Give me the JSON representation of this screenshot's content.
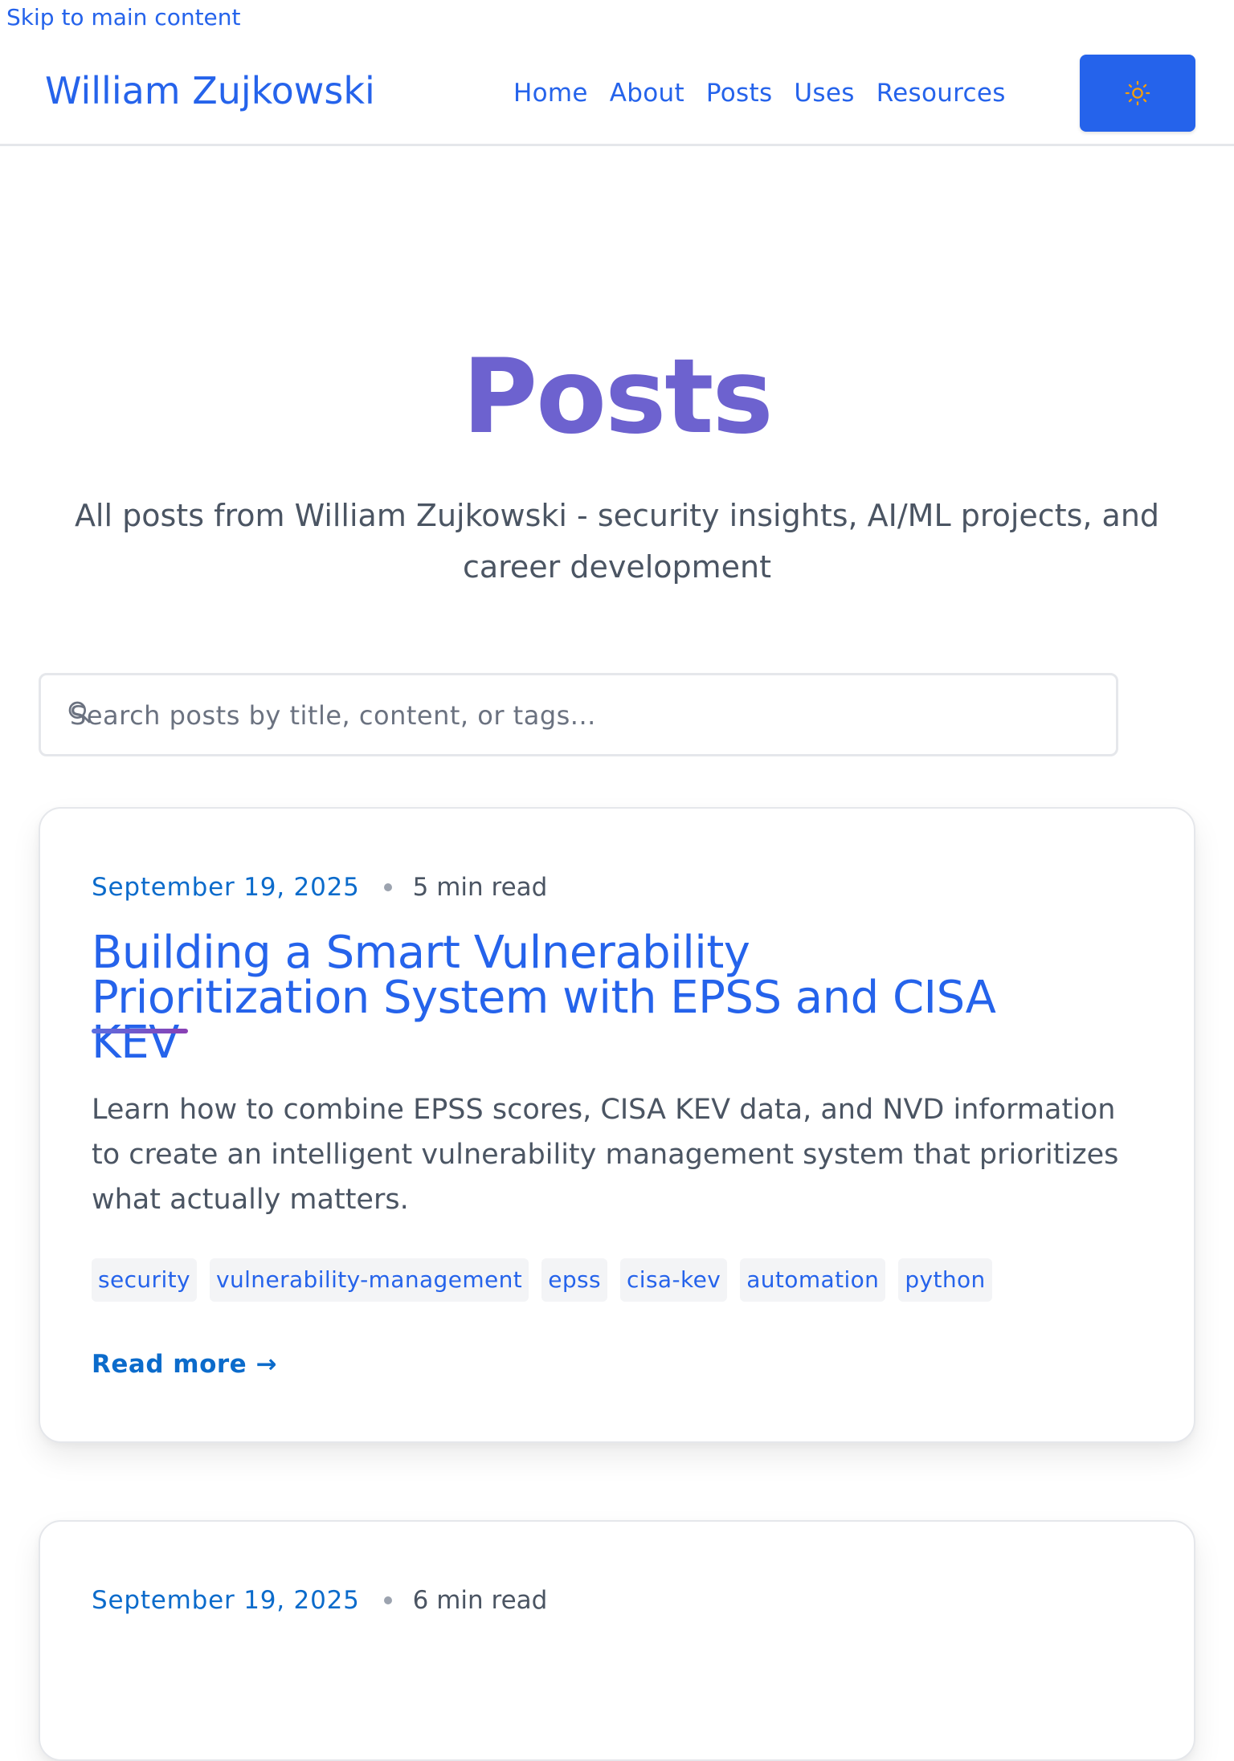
{
  "skip_link": "Skip to main content",
  "brand": "William Zujkowski",
  "nav": {
    "items": [
      "Home",
      "About",
      "Posts",
      "Uses",
      "Resources"
    ]
  },
  "theme_toggle": {
    "icon": "sun-icon"
  },
  "hero": {
    "title": "Posts",
    "subtitle": "All posts from William Zujkowski - security insights, AI/ML projects, and career development"
  },
  "search": {
    "placeholder": "Search posts by title, content, or tags..."
  },
  "posts": [
    {
      "date": "September 19, 2025",
      "read_time": "5 min read",
      "title": "Building a Smart Vulnerability Prioritization System with EPSS and CISA KEV",
      "excerpt": "Learn how to combine EPSS scores, CISA KEV data, and NVD information to create an intelligent vulnerability management system that prioritizes what actually matters.",
      "tags": [
        "security",
        "vulnerability-management",
        "epss",
        "cisa-kev",
        "automation",
        "python"
      ],
      "read_more": "Read more →"
    },
    {
      "date": "September 19, 2025",
      "read_time": "6 min read"
    }
  ],
  "colors": {
    "accent": "#2563eb",
    "hero_title": "#6d62cf",
    "date": "#0b6bcb",
    "body_text": "#4b5563"
  }
}
